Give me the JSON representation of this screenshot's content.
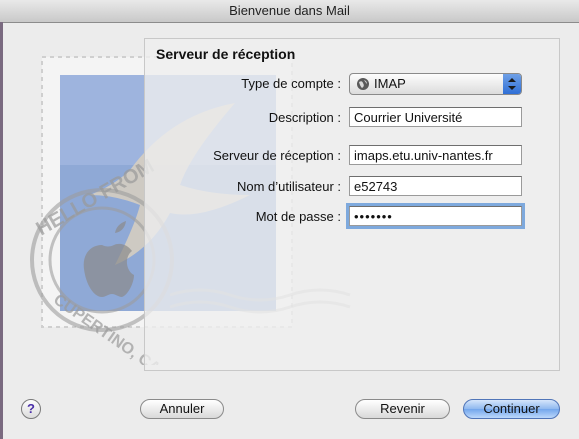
{
  "window": {
    "title": "Bienvenue dans Mail"
  },
  "section": {
    "title": "Serveur de réception"
  },
  "form": {
    "account_type_label": "Type de compte :",
    "account_type_value": "IMAP",
    "description_label": "Description :",
    "description_value": "Courrier Université",
    "server_label": "Serveur de réception :",
    "server_value": "imaps.etu.univ-nantes.fr",
    "username_label": "Nom d’utilisateur :",
    "username_value": "e52743",
    "password_label": "Mot de passe :",
    "password_value": "•••••••"
  },
  "buttons": {
    "help": "?",
    "cancel": "Annuler",
    "back": "Revenir",
    "continue": "Continuer"
  },
  "stamp": {
    "text_top": "HELLO FROM",
    "text_bottom": "CUPERTINO, CA"
  },
  "icons": {
    "account_type": "globe-icon",
    "popup": "popup-arrows-icon",
    "decorative": "mail-stamp-icon"
  },
  "colors": {
    "focus_ring": "#7ea9dd",
    "primary_button": "#73a6ec",
    "stamp_blue": "#8fa9d6"
  }
}
